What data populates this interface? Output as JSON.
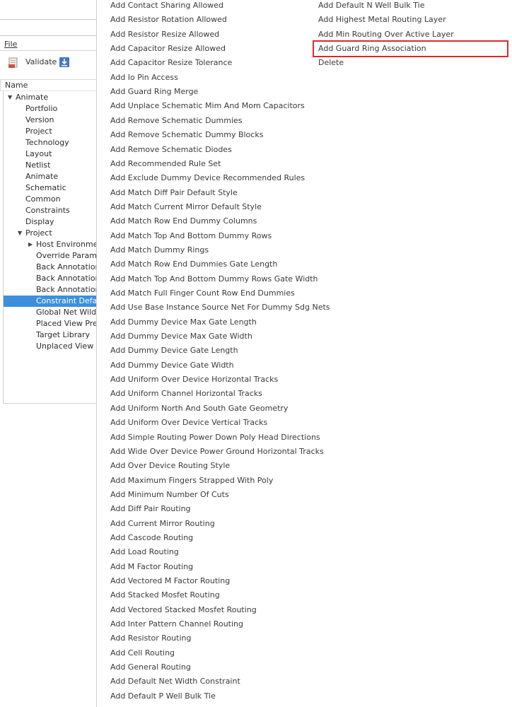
{
  "left_panel": {
    "file_menu": "File",
    "toolbar": {
      "validate_label": "Validate"
    },
    "tree_header": "Name",
    "tree": [
      {
        "label": "Animate",
        "depth": 0,
        "expanded": true
      },
      {
        "label": "Portfolio",
        "depth": 1
      },
      {
        "label": "Version",
        "depth": 1
      },
      {
        "label": "Project",
        "depth": 1
      },
      {
        "label": "Technology",
        "depth": 1
      },
      {
        "label": "Layout",
        "depth": 1
      },
      {
        "label": "Netlist",
        "depth": 1
      },
      {
        "label": "Animate",
        "depth": 1
      },
      {
        "label": "Schematic",
        "depth": 1
      },
      {
        "label": "Common",
        "depth": 1
      },
      {
        "label": "Constraints",
        "depth": 1
      },
      {
        "label": "Display",
        "depth": 1
      },
      {
        "label": "Project",
        "depth": 1,
        "expanded": true
      },
      {
        "label": "Host Environment",
        "depth": 2,
        "collapsed": true
      },
      {
        "label": "Override Paramete",
        "depth": 2
      },
      {
        "label": "Back Annotation R",
        "depth": 2
      },
      {
        "label": "Back Annotation S",
        "depth": 2
      },
      {
        "label": "Back Annotation S",
        "depth": 2
      },
      {
        "label": "Constraint Default",
        "depth": 2,
        "selected": true
      },
      {
        "label": "Global Net Wildca",
        "depth": 2
      },
      {
        "label": "Placed View Prefix",
        "depth": 2
      },
      {
        "label": "Target Library",
        "depth": 2
      },
      {
        "label": "Unplaced View",
        "depth": 2
      }
    ]
  },
  "menu": {
    "column1": [
      "Add Contact Sharing Allowed",
      "Add Resistor Rotation Allowed",
      "Add Resistor Resize Allowed",
      "Add Capacitor Resize Allowed",
      "Add Capacitor Resize Tolerance",
      "Add Io Pin Access",
      "Add Guard Ring Merge",
      "Add Unplace Schematic Mim And Mom Capacitors",
      "Add Remove Schematic Dummies",
      "Add Remove Schematic Dummy Blocks",
      "Add Remove Schematic Diodes",
      "Add Recommended Rule Set",
      "Add Exclude Dummy Device Recommended Rules",
      "Add Match Diff Pair Default Style",
      "Add Match Current Mirror Default Style",
      "Add Match Row End Dummy Columns",
      "Add Match Top And Bottom Dummy Rows",
      "Add Match Dummy Rings",
      "Add Match Row End Dummies Gate Length",
      "Add Match Top And Bottom Dummy Rows Gate Width",
      "Add Match Full Finger Count Row End Dummies",
      "Add Use Base Instance Source Net For Dummy Sdg Nets",
      "Add Dummy Device Max Gate Length",
      "Add Dummy Device Max Gate Width",
      "Add Dummy Device Gate Length",
      "Add Dummy Device Gate Width",
      "Add Uniform Over Device Horizontal Tracks",
      "Add Uniform Channel Horizontal Tracks",
      "Add Uniform North And South Gate Geometry",
      "Add Uniform Over Device Vertical Tracks",
      "Add Simple Routing Power Down Poly Head Directions",
      "Add Wide Over Device Power Ground Horizontal Tracks",
      "Add Over Device Routing Style",
      "Add Maximum Fingers Strapped With Poly",
      "Add Minimum Number Of Cuts",
      "Add Diff Pair Routing",
      "Add Current Mirror Routing",
      "Add Cascode Routing",
      "Add Load Routing",
      "Add M Factor Routing",
      "Add Vectored M Factor Routing",
      "Add Stacked Mosfet Routing",
      "Add Vectored Stacked Mosfet Routing",
      "Add Inter Pattern Channel Routing",
      "Add Resistor Routing",
      "Add Cell Routing",
      "Add General Routing",
      "Add Default Net Width Constraint",
      "Add Default P Well Bulk Tie"
    ],
    "column2": [
      "Add Default N Well Bulk Tie",
      "Add Highest Metal Routing Layer",
      "Add Min Routing Over Active Layer",
      "Add Guard Ring Association",
      "Delete"
    ],
    "highlighted_item": "Add Guard Ring Association",
    "highlight_color": "#d92b2b"
  },
  "colors": {
    "selection": "#3d8fdc",
    "text": "#3a3a3a"
  }
}
